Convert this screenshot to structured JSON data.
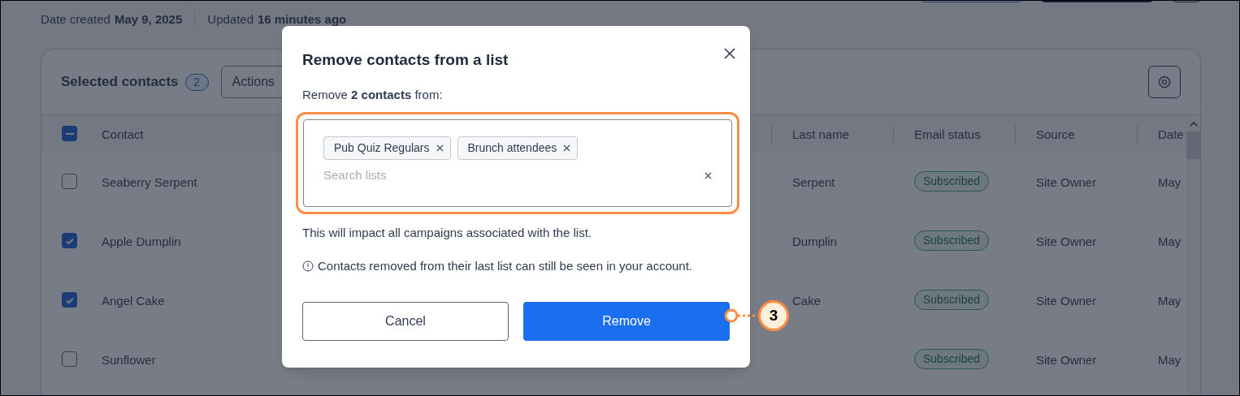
{
  "page_header": {
    "date_created_label": "Date created",
    "date_created": "May 9, 2025",
    "updated_label": "Updated",
    "updated": "16 minutes ago"
  },
  "toolbar": {
    "title": "Selected contacts",
    "count": "2",
    "actions_button": "Actions"
  },
  "table": {
    "select_all": {
      "indeterminate": true
    },
    "columns": [
      "Contact",
      "Last name",
      "Email status",
      "Source",
      "Date"
    ],
    "rows": [
      {
        "checked": false,
        "contact": "Seaberry Serpent",
        "last_name": "Serpent",
        "email_status": "Subscribed",
        "source": "Site Owner",
        "date": "May"
      },
      {
        "checked": true,
        "contact": "Apple Dumplin",
        "last_name": "Dumplin",
        "email_status": "Subscribed",
        "source": "Site Owner",
        "date": "May"
      },
      {
        "checked": true,
        "contact": "Angel Cake",
        "last_name": "Cake",
        "email_status": "Subscribed",
        "source": "Site Owner",
        "date": "May"
      },
      {
        "checked": false,
        "contact": "Sunflower",
        "email_status": "Subscribed",
        "source": "Site Owner",
        "date": "May"
      }
    ]
  },
  "dialog": {
    "title": "Remove contacts from a list",
    "prompt": "Remove **2 contacts** from:",
    "chips": [
      "Pub Quiz Regulars",
      "Brunch attendees"
    ],
    "search": {
      "placeholder": "Search lists"
    },
    "impact_note": "This will impact all campaigns associated with the list.",
    "info_note": "Contacts removed from their last list can still be seen in your account.",
    "buttons": [
      {
        "kind": "secondary",
        "label": "Cancel"
      },
      {
        "kind": "primary",
        "label": "Remove"
      }
    ]
  },
  "callout": {
    "label": "3"
  }
}
